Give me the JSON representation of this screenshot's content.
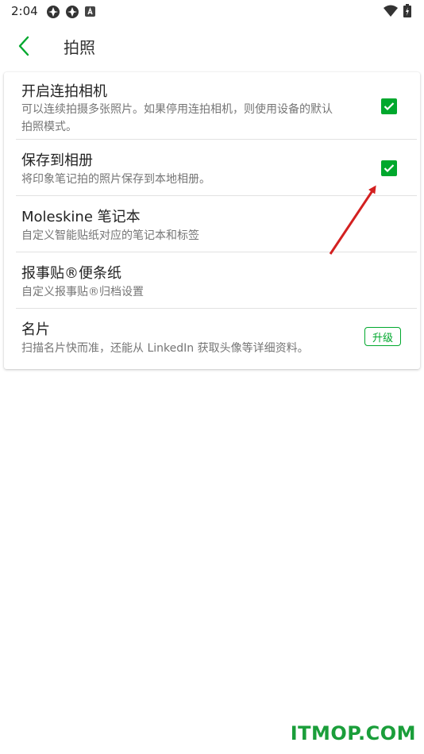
{
  "status_bar": {
    "time": "2:04",
    "icons_left": [
      "app-icon",
      "app-icon",
      "a-icon"
    ],
    "icons_right": [
      "wifi-icon",
      "battery-icon"
    ]
  },
  "toolbar": {
    "back_icon": "chevron-left-icon",
    "title": "拍照"
  },
  "settings": [
    {
      "title": "开启连拍相机",
      "desc_line1": "可以连续拍摄多张照片。如果停用连拍相机，则使用设备的默认",
      "desc_line2": "拍照模式。",
      "checked": true
    },
    {
      "title": "保存到相册",
      "desc": "将印象笔记拍的照片保存到本地相册。",
      "checked": true
    },
    {
      "title": "Moleskine 笔记本",
      "desc": "自定义智能贴纸对应的笔记本和标签"
    },
    {
      "title": "报事贴®便条纸",
      "desc": "自定义报事贴®归档设置"
    },
    {
      "title": "名片",
      "desc": "扫描名片快而准，还能从 LinkedIn 获取头像等详细资料。",
      "badge": "升级"
    }
  ],
  "colors": {
    "accent": "#00a82d",
    "arrow": "#d32020",
    "watermark": "#1a9e3a"
  },
  "watermark": "ITMOP.COM"
}
